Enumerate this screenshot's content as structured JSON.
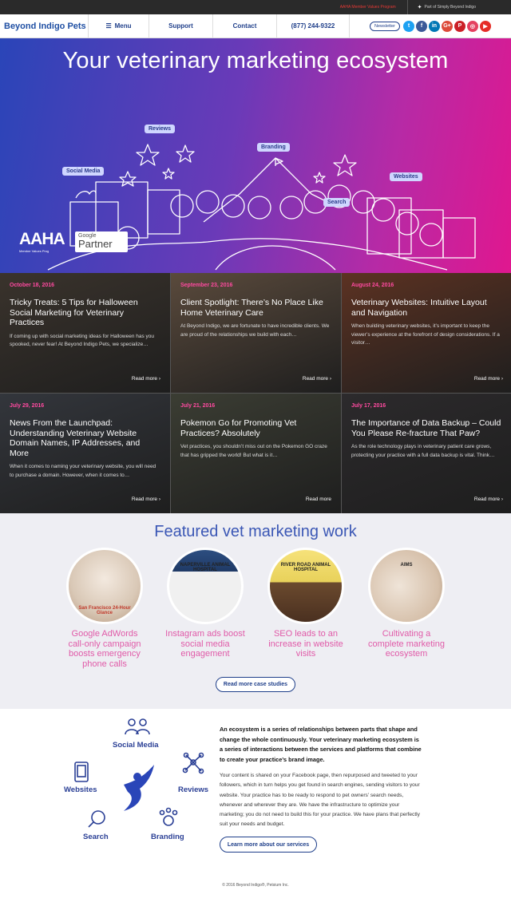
{
  "topbar": {
    "aaha_link": "AAHA Member Values Program",
    "part_of": "Part of Simply Beyond Indigo"
  },
  "nav": {
    "logo": "Beyond Indigo Pets",
    "menu": "Menu",
    "support": "Support",
    "contact": "Contact",
    "phone": "(877) 244-9322",
    "newsletter": "Newsletter",
    "social": [
      {
        "icon": "twitter-icon",
        "glyph": "t",
        "color": "#1da1f2"
      },
      {
        "icon": "facebook-icon",
        "glyph": "f",
        "color": "#3b5998"
      },
      {
        "icon": "linkedin-icon",
        "glyph": "in",
        "color": "#0077b5"
      },
      {
        "icon": "google-plus-icon",
        "glyph": "G+",
        "color": "#dd4b39"
      },
      {
        "icon": "pinterest-icon",
        "glyph": "P",
        "color": "#cb2027"
      },
      {
        "icon": "instagram-icon",
        "glyph": "◎",
        "color": "#e4405f"
      },
      {
        "icon": "youtube-icon",
        "glyph": "▶",
        "color": "#e52d27"
      }
    ]
  },
  "hero": {
    "title": "Your veterinary marketing ecosystem",
    "tags": {
      "reviews": "Reviews",
      "branding": "Branding",
      "social": "Social Media",
      "websites": "Websites",
      "search": "Search"
    },
    "aaha": "AAHA",
    "aaha_sub": "Member Values Prog",
    "google": "Google",
    "partner": "Partner"
  },
  "posts": [
    {
      "date": "October 18, 2016",
      "title": "Tricky Treats: 5 Tips for Halloween Social Marketing for Veterinary Practices",
      "excerpt": "If coming up with social marketing ideas for Halloween has you spooked, never fear! At Beyond Indigo Pets, we specialize…",
      "more": "Read more ›",
      "bg": "#3a332c"
    },
    {
      "date": "September 23, 2016",
      "title": "Client Spotlight: There’s No Place Like Home Veterinary Care",
      "excerpt": "At Beyond Indigo, we are fortunate to have incredible clients. We are proud of the relationships we build with each…",
      "more": "Read more ›",
      "bg": "#5a4a3c"
    },
    {
      "date": "August 24, 2016",
      "title": "Veterinary Websites: Intuitive Layout and Navigation",
      "excerpt": "When building veterinary websites, it’s important to keep the viewer’s experience at the forefront of design considerations. If a visitor…",
      "more": "Read more ›",
      "bg": "#5c3222"
    },
    {
      "date": "July 29, 2016",
      "title": "News From the Launchpad: Understanding Veterinary Website Domain Names, IP Addresses, and More",
      "excerpt": "When it comes to naming your veterinary website, you will need to purchase a domain. However, when it comes to…",
      "more": "Read more ›",
      "bg": "#33363c"
    },
    {
      "date": "July 21, 2016",
      "title": "Pokemon Go for Promoting Vet Practices? Absolutely",
      "excerpt": "Vet practices, you shouldn’t miss out on the Pokemon GO craze that has gripped the world! But what is it…",
      "more": "Read more",
      "bg": "#3b3d33"
    },
    {
      "date": "July 17, 2016",
      "title": "The Importance of Data Backup – Could You Please Re-fracture That Paw?",
      "excerpt": "As the role technology plays in veterinary patient care grows, protecting your practice with a full data backup is vital. Think…",
      "more": "Read more ›",
      "bg": "#2c2a2c"
    }
  ],
  "featured": {
    "title": "Featured vet marketing work",
    "items": [
      {
        "caption": "Google AdWords call-only campaign boosts emergency phone calls",
        "img_text": "San Francisco 24-Hour Glance"
      },
      {
        "caption": "Instagram ads boost social media engagement",
        "img_text": "NAPERVILLE ANIMAL HOSPITAL"
      },
      {
        "caption": "SEO leads to an increase in website visits",
        "img_text": "RIVER ROAD ANIMAL HOSPITAL"
      },
      {
        "caption": "Cultivating a complete marketing ecosystem",
        "img_text": "AIMS"
      }
    ],
    "button": "Read more case studies"
  },
  "eco": {
    "labels": {
      "social": "Social Media",
      "websites": "Websites",
      "reviews": "Reviews",
      "search": "Search",
      "branding": "Branding"
    },
    "lead": "An ecosystem is a series of relationships between parts that shape and change the whole continuously. Your veterinary marketing ecosystem is a series of interactions between the services and platforms that combine to create your practice’s brand image.",
    "body": "Your content is shared on your Facebook page, then repurposed and tweeted to your followers, which in turn helps you get found in search engines, sending visitors to your website. Your practice has to be ready to respond to pet owners’ search needs, whenever and wherever they are. We have the infrastructure to optimize your marketing; you do not need to build this for your practice. We have plans that perfectly suit your needs and budget.",
    "button": "Learn more about our services",
    "footer": "© 2016 Beyond Indigo®, Petsium Inc."
  }
}
